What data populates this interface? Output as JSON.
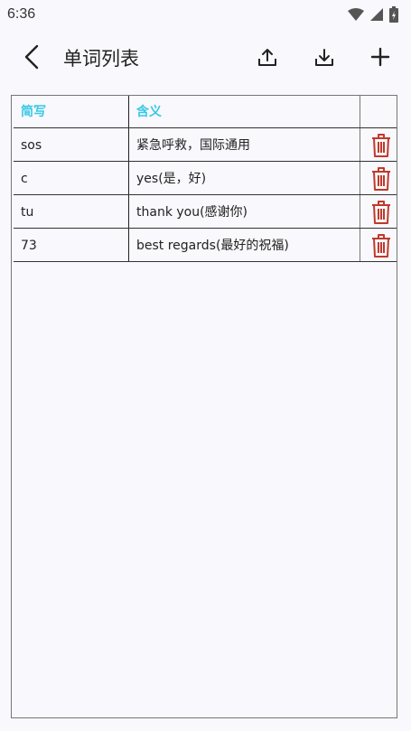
{
  "status_bar": {
    "time": "6:36",
    "icons": [
      "wifi-icon",
      "signal-icon",
      "battery-icon"
    ]
  },
  "app_bar": {
    "title": "单词列表",
    "icons": [
      "back-arrow-icon",
      "upload-icon",
      "download-icon",
      "plus-icon"
    ]
  },
  "table": {
    "headers": [
      "简写",
      "含义"
    ],
    "rows": [
      {
        "abbr": "sos",
        "meaning": "紧急呼救，国际通用"
      },
      {
        "abbr": "c",
        "meaning": "yes(是，好)"
      },
      {
        "abbr": "tu",
        "meaning": "thank you(感谢你)"
      },
      {
        "abbr": "73",
        "meaning": "best regards(最好的祝福)"
      }
    ],
    "delete_icon": "trash-icon"
  },
  "colors": {
    "background": "#f8f8fd",
    "header_text": "#38c8e4",
    "delete_icon": "#c0392b"
  }
}
